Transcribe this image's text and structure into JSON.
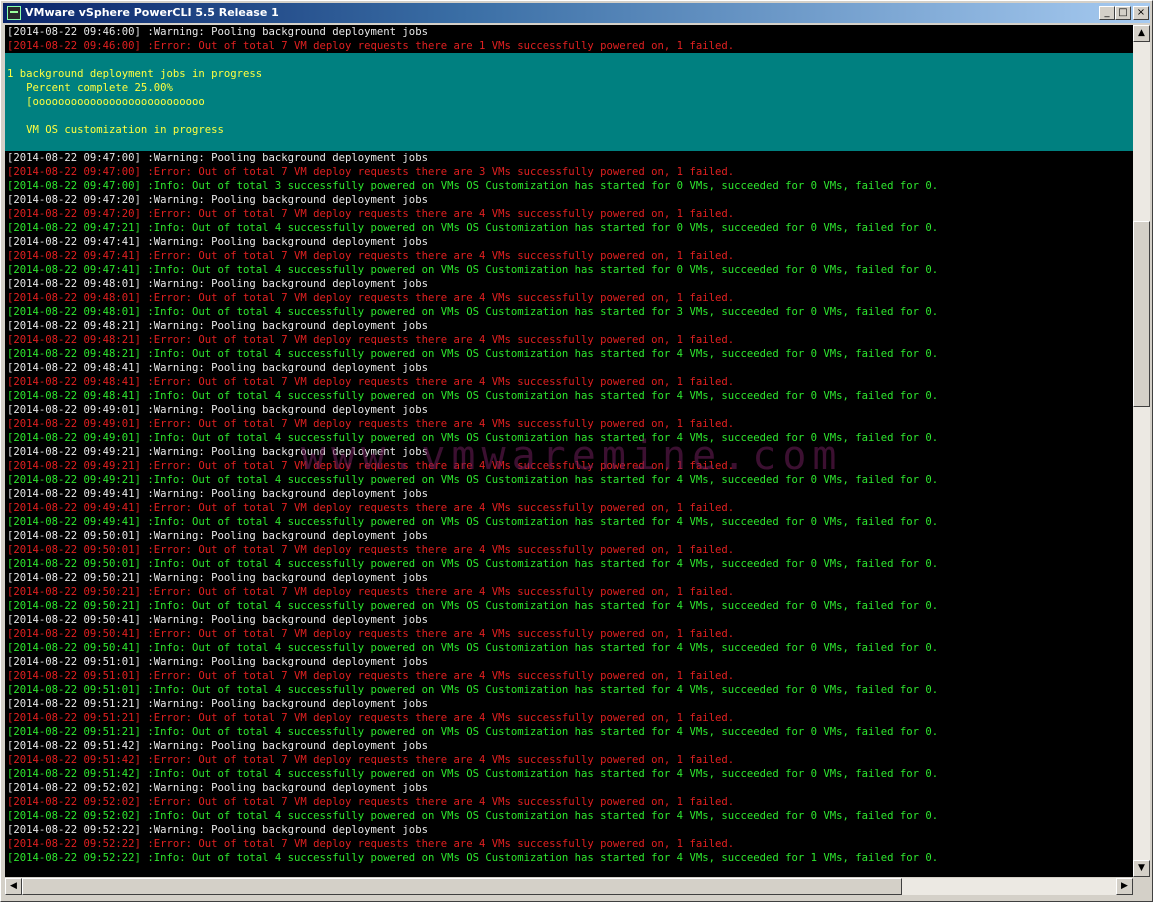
{
  "window": {
    "title": "VMware vSphere PowerCLI 5.5 Release 1"
  },
  "progress": {
    "lines": [
      "1 background deployment jobs in progress",
      "   Percent complete 25.00%",
      "   [ooooooooooooooooooooooooooo",
      "",
      "   VM OS customization in progress"
    ]
  },
  "watermark": "www.vmwaremine.com",
  "pre_lines": [
    {
      "type": "warn",
      "text": "[2014-08-22 09:46:00] :Warning: Pooling background deployment jobs"
    },
    {
      "type": "err",
      "text": "[2014-08-22 09:46:00] :Error: Out of total 7 VM deploy requests there are 1 VMs successfully powered on, 1 failed."
    }
  ],
  "log_lines": [
    {
      "type": "warn",
      "text": "[2014-08-22 09:47:00] :Warning: Pooling background deployment jobs"
    },
    {
      "type": "err",
      "text": "[2014-08-22 09:47:00] :Error: Out of total 7 VM deploy requests there are 3 VMs successfully powered on, 1 failed."
    },
    {
      "type": "info",
      "text": "[2014-08-22 09:47:00] :Info: Out of total 3 successfully powered on VMs OS Customization has started for 0 VMs, succeeded for 0 VMs, failed for 0."
    },
    {
      "type": "warn",
      "text": "[2014-08-22 09:47:20] :Warning: Pooling background deployment jobs"
    },
    {
      "type": "err",
      "text": "[2014-08-22 09:47:20] :Error: Out of total 7 VM deploy requests there are 4 VMs successfully powered on, 1 failed."
    },
    {
      "type": "info",
      "text": "[2014-08-22 09:47:21] :Info: Out of total 4 successfully powered on VMs OS Customization has started for 0 VMs, succeeded for 0 VMs, failed for 0."
    },
    {
      "type": "warn",
      "text": "[2014-08-22 09:47:41] :Warning: Pooling background deployment jobs"
    },
    {
      "type": "err",
      "text": "[2014-08-22 09:47:41] :Error: Out of total 7 VM deploy requests there are 4 VMs successfully powered on, 1 failed."
    },
    {
      "type": "info",
      "text": "[2014-08-22 09:47:41] :Info: Out of total 4 successfully powered on VMs OS Customization has started for 0 VMs, succeeded for 0 VMs, failed for 0."
    },
    {
      "type": "warn",
      "text": "[2014-08-22 09:48:01] :Warning: Pooling background deployment jobs"
    },
    {
      "type": "err",
      "text": "[2014-08-22 09:48:01] :Error: Out of total 7 VM deploy requests there are 4 VMs successfully powered on, 1 failed."
    },
    {
      "type": "info",
      "text": "[2014-08-22 09:48:01] :Info: Out of total 4 successfully powered on VMs OS Customization has started for 3 VMs, succeeded for 0 VMs, failed for 0."
    },
    {
      "type": "warn",
      "text": "[2014-08-22 09:48:21] :Warning: Pooling background deployment jobs"
    },
    {
      "type": "err",
      "text": "[2014-08-22 09:48:21] :Error: Out of total 7 VM deploy requests there are 4 VMs successfully powered on, 1 failed."
    },
    {
      "type": "info",
      "text": "[2014-08-22 09:48:21] :Info: Out of total 4 successfully powered on VMs OS Customization has started for 4 VMs, succeeded for 0 VMs, failed for 0."
    },
    {
      "type": "warn",
      "text": "[2014-08-22 09:48:41] :Warning: Pooling background deployment jobs"
    },
    {
      "type": "err",
      "text": "[2014-08-22 09:48:41] :Error: Out of total 7 VM deploy requests there are 4 VMs successfully powered on, 1 failed."
    },
    {
      "type": "info",
      "text": "[2014-08-22 09:48:41] :Info: Out of total 4 successfully powered on VMs OS Customization has started for 4 VMs, succeeded for 0 VMs, failed for 0."
    },
    {
      "type": "warn",
      "text": "[2014-08-22 09:49:01] :Warning: Pooling background deployment jobs"
    },
    {
      "type": "err",
      "text": "[2014-08-22 09:49:01] :Error: Out of total 7 VM deploy requests there are 4 VMs successfully powered on, 1 failed."
    },
    {
      "type": "info",
      "text": "[2014-08-22 09:49:01] :Info: Out of total 4 successfully powered on VMs OS Customization has started for 4 VMs, succeeded for 0 VMs, failed for 0."
    },
    {
      "type": "warn",
      "text": "[2014-08-22 09:49:21] :Warning: Pooling background deployment jobs"
    },
    {
      "type": "err",
      "text": "[2014-08-22 09:49:21] :Error: Out of total 7 VM deploy requests there are 4 VMs successfully powered on, 1 failed."
    },
    {
      "type": "info",
      "text": "[2014-08-22 09:49:21] :Info: Out of total 4 successfully powered on VMs OS Customization has started for 4 VMs, succeeded for 0 VMs, failed for 0."
    },
    {
      "type": "warn",
      "text": "[2014-08-22 09:49:41] :Warning: Pooling background deployment jobs"
    },
    {
      "type": "err",
      "text": "[2014-08-22 09:49:41] :Error: Out of total 7 VM deploy requests there are 4 VMs successfully powered on, 1 failed."
    },
    {
      "type": "info",
      "text": "[2014-08-22 09:49:41] :Info: Out of total 4 successfully powered on VMs OS Customization has started for 4 VMs, succeeded for 0 VMs, failed for 0."
    },
    {
      "type": "warn",
      "text": "[2014-08-22 09:50:01] :Warning: Pooling background deployment jobs"
    },
    {
      "type": "err",
      "text": "[2014-08-22 09:50:01] :Error: Out of total 7 VM deploy requests there are 4 VMs successfully powered on, 1 failed."
    },
    {
      "type": "info",
      "text": "[2014-08-22 09:50:01] :Info: Out of total 4 successfully powered on VMs OS Customization has started for 4 VMs, succeeded for 0 VMs, failed for 0."
    },
    {
      "type": "warn",
      "text": "[2014-08-22 09:50:21] :Warning: Pooling background deployment jobs"
    },
    {
      "type": "err",
      "text": "[2014-08-22 09:50:21] :Error: Out of total 7 VM deploy requests there are 4 VMs successfully powered on, 1 failed."
    },
    {
      "type": "info",
      "text": "[2014-08-22 09:50:21] :Info: Out of total 4 successfully powered on VMs OS Customization has started for 4 VMs, succeeded for 0 VMs, failed for 0."
    },
    {
      "type": "warn",
      "text": "[2014-08-22 09:50:41] :Warning: Pooling background deployment jobs"
    },
    {
      "type": "err",
      "text": "[2014-08-22 09:50:41] :Error: Out of total 7 VM deploy requests there are 4 VMs successfully powered on, 1 failed."
    },
    {
      "type": "info",
      "text": "[2014-08-22 09:50:41] :Info: Out of total 4 successfully powered on VMs OS Customization has started for 4 VMs, succeeded for 0 VMs, failed for 0."
    },
    {
      "type": "warn",
      "text": "[2014-08-22 09:51:01] :Warning: Pooling background deployment jobs"
    },
    {
      "type": "err",
      "text": "[2014-08-22 09:51:01] :Error: Out of total 7 VM deploy requests there are 4 VMs successfully powered on, 1 failed."
    },
    {
      "type": "info",
      "text": "[2014-08-22 09:51:01] :Info: Out of total 4 successfully powered on VMs OS Customization has started for 4 VMs, succeeded for 0 VMs, failed for 0."
    },
    {
      "type": "warn",
      "text": "[2014-08-22 09:51:21] :Warning: Pooling background deployment jobs"
    },
    {
      "type": "err",
      "text": "[2014-08-22 09:51:21] :Error: Out of total 7 VM deploy requests there are 4 VMs successfully powered on, 1 failed."
    },
    {
      "type": "info",
      "text": "[2014-08-22 09:51:21] :Info: Out of total 4 successfully powered on VMs OS Customization has started for 4 VMs, succeeded for 0 VMs, failed for 0."
    },
    {
      "type": "warn",
      "text": "[2014-08-22 09:51:42] :Warning: Pooling background deployment jobs"
    },
    {
      "type": "err",
      "text": "[2014-08-22 09:51:42] :Error: Out of total 7 VM deploy requests there are 4 VMs successfully powered on, 1 failed."
    },
    {
      "type": "info",
      "text": "[2014-08-22 09:51:42] :Info: Out of total 4 successfully powered on VMs OS Customization has started for 4 VMs, succeeded for 0 VMs, failed for 0."
    },
    {
      "type": "warn",
      "text": "[2014-08-22 09:52:02] :Warning: Pooling background deployment jobs"
    },
    {
      "type": "err",
      "text": "[2014-08-22 09:52:02] :Error: Out of total 7 VM deploy requests there are 4 VMs successfully powered on, 1 failed."
    },
    {
      "type": "info",
      "text": "[2014-08-22 09:52:02] :Info: Out of total 4 successfully powered on VMs OS Customization has started for 4 VMs, succeeded for 0 VMs, failed for 0."
    },
    {
      "type": "warn",
      "text": "[2014-08-22 09:52:22] :Warning: Pooling background deployment jobs"
    },
    {
      "type": "err",
      "text": "[2014-08-22 09:52:22] :Error: Out of total 7 VM deploy requests there are 4 VMs successfully powered on, 1 failed."
    },
    {
      "type": "info",
      "text": "[2014-08-22 09:52:22] :Info: Out of total 4 successfully powered on VMs OS Customization has started for 4 VMs, succeeded for 1 VMs, failed for 0."
    }
  ],
  "controls": {
    "minimize_glyph": "_",
    "maximize_glyph": "□",
    "close_glyph": "×",
    "scroll_up_glyph": "▲",
    "scroll_down_glyph": "▼",
    "scroll_left_glyph": "◀",
    "scroll_right_glyph": "▶"
  },
  "colors": {
    "warning": "#e8e8e8",
    "error": "#e02020",
    "info": "#2ee62e",
    "progress_bg": "#008080",
    "progress_text": "#ffff40"
  }
}
